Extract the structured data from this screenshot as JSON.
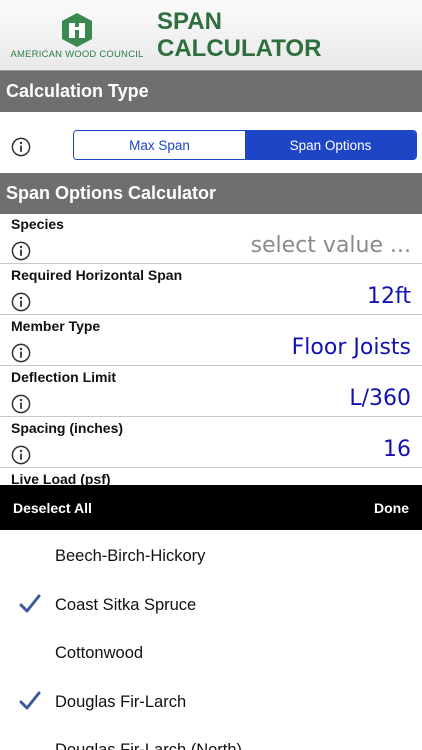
{
  "header": {
    "org_name": "AMERICAN WOOD COUNCIL",
    "title_line1": "SPAN",
    "title_line2": "CALCULATOR",
    "brand_color": "#2f6e3d"
  },
  "calculation_type": {
    "heading": "Calculation Type",
    "options": [
      "Max Span",
      "Span Options"
    ],
    "selected": "Span Options"
  },
  "calculator": {
    "heading": "Span Options Calculator",
    "fields": [
      {
        "label": "Species",
        "value": "select value ...",
        "is_placeholder": true
      },
      {
        "label": "Required Horizontal Span",
        "value": "12ft"
      },
      {
        "label": "Member Type",
        "value": "Floor Joists"
      },
      {
        "label": "Deflection Limit",
        "value": "L/360"
      },
      {
        "label": "Spacing (inches)",
        "value": "16"
      },
      {
        "label": "Live Load (psf)",
        "value": ""
      }
    ]
  },
  "picker": {
    "deselect_label": "Deselect All",
    "done_label": "Done",
    "options": [
      {
        "label": "Beech-Birch-Hickory",
        "checked": false
      },
      {
        "label": "Coast Sitka Spruce",
        "checked": true
      },
      {
        "label": "Cottonwood",
        "checked": false
      },
      {
        "label": "Douglas Fir-Larch",
        "checked": true
      },
      {
        "label": "Douglas Fir-Larch (North)",
        "checked": false
      }
    ]
  },
  "colors": {
    "accent": "#1d45c6",
    "value_text": "#1212b0",
    "section_bar": "#6f6f6f",
    "check": "#3c5a99"
  },
  "icons": [
    "info-icon",
    "checkmark-icon",
    "awc-logo-icon"
  ]
}
